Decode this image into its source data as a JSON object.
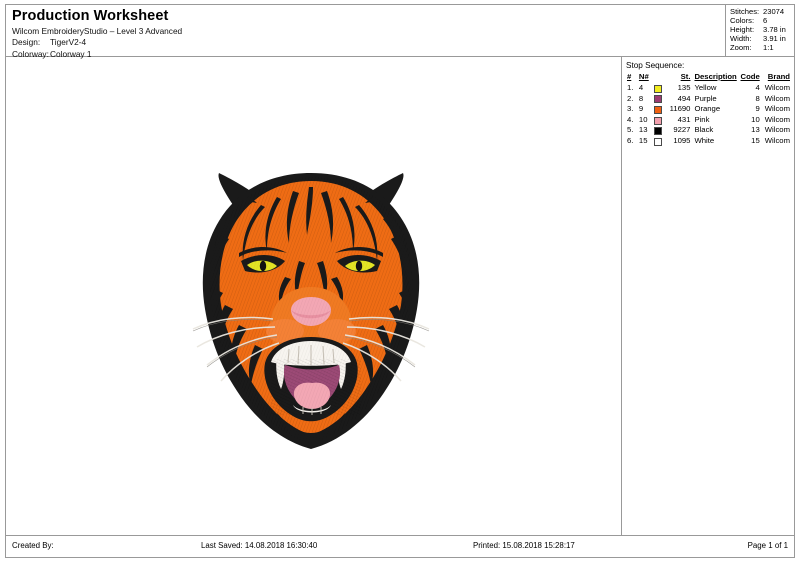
{
  "header": {
    "title": "Production Worksheet",
    "app_line": "Wilcom EmbroideryStudio – Level 3 Advanced",
    "design_label": "Design:",
    "design_value": "TigerV2-4",
    "colorway_label": "Colorway:",
    "colorway_value": "Colorway 1"
  },
  "stats": {
    "rows": [
      {
        "label": "Stitches:",
        "value": "23074"
      },
      {
        "label": "Colors:",
        "value": "6"
      },
      {
        "label": "Height:",
        "value": "3.78 in"
      },
      {
        "label": "Width:",
        "value": "3.91 in"
      },
      {
        "label": "Zoom:",
        "value": "1:1"
      }
    ]
  },
  "stop_sequence": {
    "title": "Stop Sequence:",
    "columns": {
      "index": "#",
      "needle": "N#",
      "swatch": "",
      "stitches": "St.",
      "description": "Description",
      "code": "Code",
      "brand": "Brand"
    },
    "rows": [
      {
        "index": "1.",
        "needle": "4",
        "color": "#f2ec1f",
        "stitches": "135",
        "description": "Yellow",
        "code": "4",
        "brand": "Wilcom"
      },
      {
        "index": "2.",
        "needle": "8",
        "color": "#9c3b72",
        "stitches": "494",
        "description": "Purple",
        "code": "8",
        "brand": "Wilcom"
      },
      {
        "index": "3.",
        "needle": "9",
        "color": "#f06010",
        "stitches": "11690",
        "description": "Orange",
        "code": "9",
        "brand": "Wilcom"
      },
      {
        "index": "4.",
        "needle": "10",
        "color": "#f4a0ae",
        "stitches": "431",
        "description": "Pink",
        "code": "10",
        "brand": "Wilcom"
      },
      {
        "index": "5.",
        "needle": "13",
        "color": "#000000",
        "stitches": "9227",
        "description": "Black",
        "code": "13",
        "brand": "Wilcom"
      },
      {
        "index": "6.",
        "needle": "15",
        "color": "#ffffff",
        "stitches": "1095",
        "description": "White",
        "code": "15",
        "brand": "Wilcom"
      }
    ]
  },
  "design": {
    "name": "TigerV2-4",
    "artwork": "embroidered-tiger-head",
    "palette": {
      "orange": "#ef6c14",
      "orange_dark": "#d4590c",
      "black": "#1a1a1a",
      "white": "#f7f4ef",
      "pink": "#f3a7b4",
      "purple": "#9c4a76",
      "yellow": "#e3e425"
    }
  },
  "footer": {
    "created_by": "Created By:",
    "last_saved": "Last Saved: 14.08.2018 16:30:40",
    "printed": "Printed: 15.08.2018 15:28:17",
    "page": "Page 1 of 1"
  }
}
